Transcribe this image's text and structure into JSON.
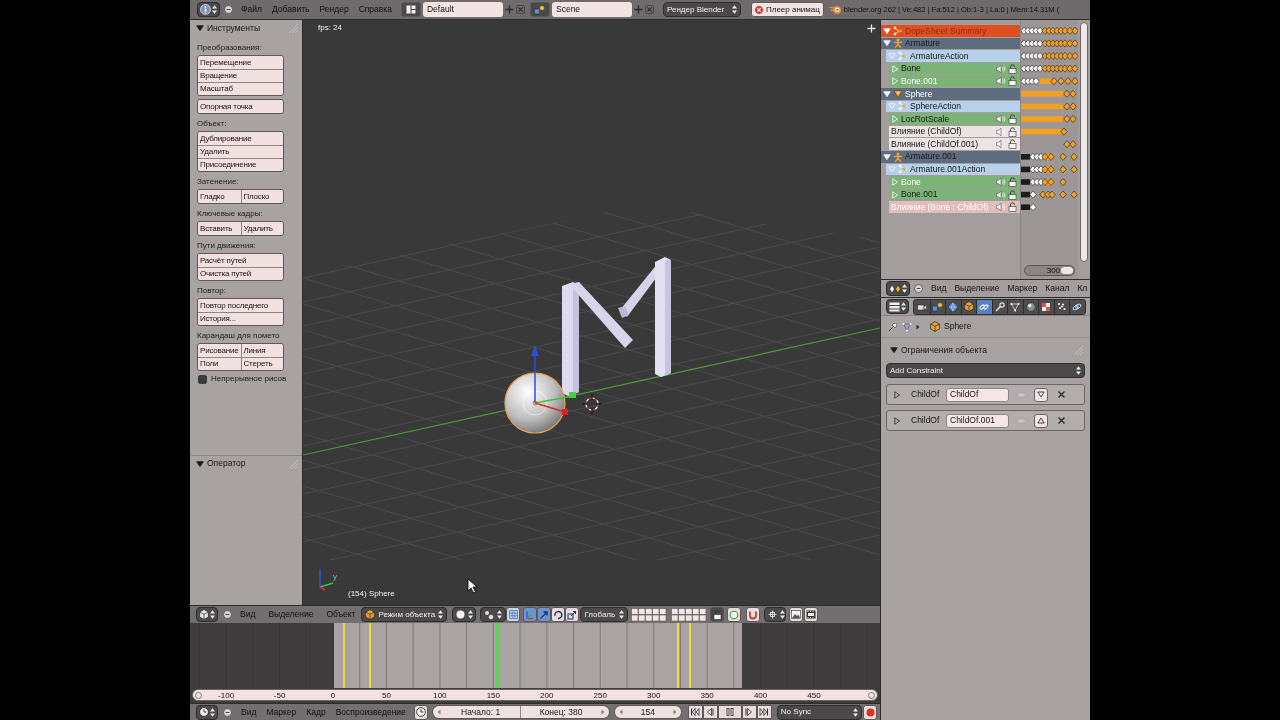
{
  "info_bar": {
    "menus": [
      "Файл",
      "Добавить",
      "Рендер",
      "Справка"
    ],
    "screen": "Default",
    "scene": "Scene",
    "render_engine": "Рендер Blender",
    "playback_button": "Плеер анимац",
    "stats": "blender.org 262 | Ve:482 | Fa:512 | Ob:1-3 | La:0 | Mem:14.31M ("
  },
  "tool_shelf": {
    "title": "Инструменты",
    "expanded": true,
    "sections": [
      {
        "kind": "column",
        "label": "Преобразования:",
        "buttons": [
          "Перемещение",
          "Вращение",
          "Масштаб"
        ]
      },
      {
        "kind": "column",
        "buttons": [
          "Опорная точка"
        ]
      },
      {
        "kind": "column",
        "label": "Объект:",
        "buttons": [
          "Дублирование",
          "Удалить",
          "Присоединение"
        ]
      },
      {
        "kind": "grid",
        "label": "Затенение:",
        "buttons": [
          "Гладко",
          "Плоско"
        ]
      },
      {
        "kind": "grid",
        "label": "Ключевые кадры:",
        "buttons": [
          "Вставить",
          "Удалить"
        ]
      },
      {
        "kind": "column",
        "label": "Пути движения:",
        "buttons": [
          "Расчёт путей",
          "Очистка путей"
        ]
      },
      {
        "kind": "column",
        "label": "Повтор:",
        "buttons": [
          "Повтор последнего",
          "История..."
        ]
      },
      {
        "kind": "grid",
        "label": "Карандаш для помето",
        "buttons": [
          "Рисование",
          "Линия",
          "Поли",
          "Стереть"
        ]
      },
      {
        "kind": "checkbox",
        "label": "Непрерывное рисов",
        "checked": false
      }
    ]
  },
  "operator_panel": {
    "title": "Оператор",
    "expanded": true
  },
  "viewport": {
    "fps": "fps: 24",
    "axis_label": "y",
    "object_label": "(154) Sphere"
  },
  "viewport_header": {
    "menus": [
      "Вид",
      "Выделение",
      "Объект"
    ],
    "mode": "Режим объекта",
    "manipulators": [
      {
        "kind": "toggle",
        "selected": true
      },
      {
        "kind": "translate",
        "selected": true
      },
      {
        "kind": "rotate",
        "selected": false
      },
      {
        "kind": "scale",
        "selected": false
      }
    ],
    "orientation": "Глобаль"
  },
  "timeline": {
    "ruler": [
      "-100",
      "-50",
      "0",
      "50",
      "100",
      "150",
      "200",
      "250",
      "300",
      "350",
      "400",
      "450"
    ]
  },
  "timeline_header": {
    "menus": [
      "Вид",
      "Маркер",
      "Кадр",
      "Воспроизведение"
    ],
    "start": "Начало: 1",
    "end": "Конец: 380",
    "frame": "154",
    "sync": "No Sync"
  },
  "dopesheet": {
    "channels": [
      {
        "kind": "summary",
        "name": "DopeSheet Summary",
        "selected": false,
        "expanded": true,
        "children": [
          {
            "kind": "armature",
            "name": "Armature",
            "selected": false,
            "expanded": true,
            "children": [
              {
                "kind": "action",
                "name": "ArmatureAction",
                "selected": false,
                "expanded": true,
                "children": [
                  {
                    "kind": "group",
                    "name": "Bone",
                    "selected": false,
                    "expanded": false
                  },
                  {
                    "kind": "group",
                    "name": "Bone.001",
                    "selected": true,
                    "expanded": false
                  }
                ]
              }
            ]
          },
          {
            "kind": "mesh",
            "name": "Sphere",
            "selected": true,
            "expanded": true,
            "children": [
              {
                "kind": "action",
                "name": "SphereAction",
                "selected": false,
                "expanded": true,
                "children": [
                  {
                    "kind": "group",
                    "name": "LocRotScale",
                    "selected": false,
                    "expanded": false
                  },
                  {
                    "kind": "fcurve",
                    "name": "Влияние (ChildOf)",
                    "selected": false
                  },
                  {
                    "kind": "fcurve",
                    "name": "Влияние (ChildOf.001)",
                    "selected": false
                  }
                ]
              }
            ]
          },
          {
            "kind": "armature",
            "name": "Armature.001",
            "selected": false,
            "expanded": true,
            "children": [
              {
                "kind": "action",
                "name": "Armature.001Action",
                "selected": false,
                "expanded": true,
                "children": [
                  {
                    "kind": "group",
                    "name": "Bone",
                    "selected": true,
                    "expanded": false
                  },
                  {
                    "kind": "group",
                    "name": "Bone.001",
                    "selected": false,
                    "expanded": false
                  },
                  {
                    "kind": "fcurve",
                    "name": "Влияние (Bone : ChildOf)",
                    "selected": true
                  }
                ]
              }
            ]
          }
        ]
      }
    ],
    "scroll_frame": "300"
  },
  "dopesheet_header": {
    "menus": [
      "Вид",
      "Выделение",
      "Маркер",
      "Канал",
      "Кл"
    ]
  },
  "properties": {
    "tabs": [
      {
        "kind": "render",
        "selected": false
      },
      {
        "kind": "scene",
        "selected": false
      },
      {
        "kind": "world",
        "selected": false
      },
      {
        "kind": "object",
        "selected": false
      },
      {
        "kind": "constraints",
        "selected": true
      },
      {
        "kind": "modifiers",
        "selected": false
      },
      {
        "kind": "data",
        "selected": false
      },
      {
        "kind": "material",
        "selected": false
      },
      {
        "kind": "texture",
        "selected": false
      },
      {
        "kind": "particles",
        "selected": false
      },
      {
        "kind": "physics",
        "selected": false
      }
    ],
    "breadcrumb": "Sphere",
    "panel": {
      "title": "Ограничения объекта",
      "expanded": true
    },
    "add_constraint": "Add Constraint",
    "constraints": [
      {
        "type": "ChildOf",
        "name": "ChildOf",
        "expanded": false
      },
      {
        "type": "ChildOf",
        "name": "ChildOf.001",
        "expanded": false
      }
    ]
  }
}
